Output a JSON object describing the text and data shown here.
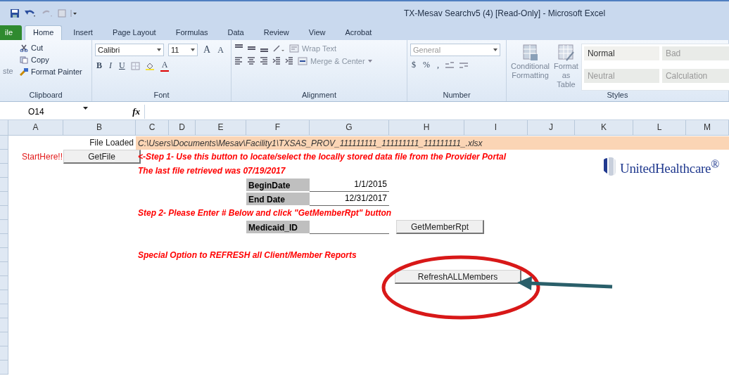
{
  "window": {
    "title": "TX-Mesav Searchv5 (4)  [Read-Only] - Microsoft Excel"
  },
  "tabs": [
    {
      "label": "ile",
      "kind": "file",
      "selected": false
    },
    {
      "label": "Home",
      "kind": "tab",
      "selected": true
    },
    {
      "label": "Insert",
      "kind": "tab",
      "selected": false
    },
    {
      "label": "Page Layout",
      "kind": "tab",
      "selected": false
    },
    {
      "label": "Formulas",
      "kind": "tab",
      "selected": false
    },
    {
      "label": "Data",
      "kind": "tab",
      "selected": false
    },
    {
      "label": "Review",
      "kind": "tab",
      "selected": false
    },
    {
      "label": "View",
      "kind": "tab",
      "selected": false
    },
    {
      "label": "Acrobat",
      "kind": "tab",
      "selected": false
    }
  ],
  "ribbon": {
    "clipboard": {
      "paste_label": "ste",
      "commands": [
        "Cut",
        "Copy",
        "Format Painter"
      ],
      "label": "Clipboard"
    },
    "font": {
      "name": "Calibri",
      "size": "11",
      "grow": "A",
      "shrink": "A",
      "bold": "B",
      "italic": "I",
      "underline": "U",
      "color_letter": "A",
      "label": "Font"
    },
    "alignment": {
      "wrap": "Wrap Text",
      "merge": "Merge & Center",
      "label": "Alignment"
    },
    "number": {
      "format": "General",
      "currency": "$",
      "percent": "%",
      "comma": ",",
      "label": "Number"
    },
    "styles": {
      "conditional": "Conditional Formatting",
      "table": "Format as Table",
      "cells": [
        {
          "label": "Normal"
        },
        {
          "label": "Bad"
        },
        {
          "label": "Neutral"
        },
        {
          "label": "Calculation"
        }
      ],
      "label": "Styles"
    }
  },
  "formula_bar": {
    "name_box": "O14",
    "fx": "fx"
  },
  "columns": [
    "A",
    "B",
    "C",
    "D",
    "E",
    "F",
    "G",
    "H",
    "I",
    "J",
    "K",
    "L",
    "M"
  ],
  "cells": [
    {
      "kind": "label",
      "text": "File Loaded"
    },
    {
      "kind": "path",
      "text": "C:\\Users\\Documents\\Mesav\\Facility1\\TXSAS_PROV_111111111_111111111_111111111_.xlsx"
    },
    {
      "kind": "note",
      "text": "StartHere!!"
    },
    {
      "kind": "button",
      "text": "GetFile"
    },
    {
      "kind": "instruction",
      "text": "<-Step 1- Use this button to locate/select the locally stored data file from the Provider Portal"
    },
    {
      "kind": "instruction",
      "text": "The last file retrieved was 07/19/2017"
    },
    {
      "kind": "field_label",
      "text": "BeginDate"
    },
    {
      "kind": "value",
      "text": "1/1/2015"
    },
    {
      "kind": "field_label",
      "text": "End Date"
    },
    {
      "kind": "value",
      "text": "12/31/2017"
    },
    {
      "kind": "instruction",
      "text": "Step 2- Please Enter # Below and click \"GetMemberRpt\" button"
    },
    {
      "kind": "field_label",
      "text": "Medicaid_ID"
    },
    {
      "kind": "input"
    },
    {
      "kind": "button",
      "text": "GetMemberRpt"
    },
    {
      "kind": "instruction",
      "text": "Special Option to REFRESH all Client/Member Reports"
    },
    {
      "kind": "wide_button",
      "text": "RefreshALLMembers"
    }
  ],
  "logo": {
    "text": "UnitedHealthcare$^{®}$"
  }
}
